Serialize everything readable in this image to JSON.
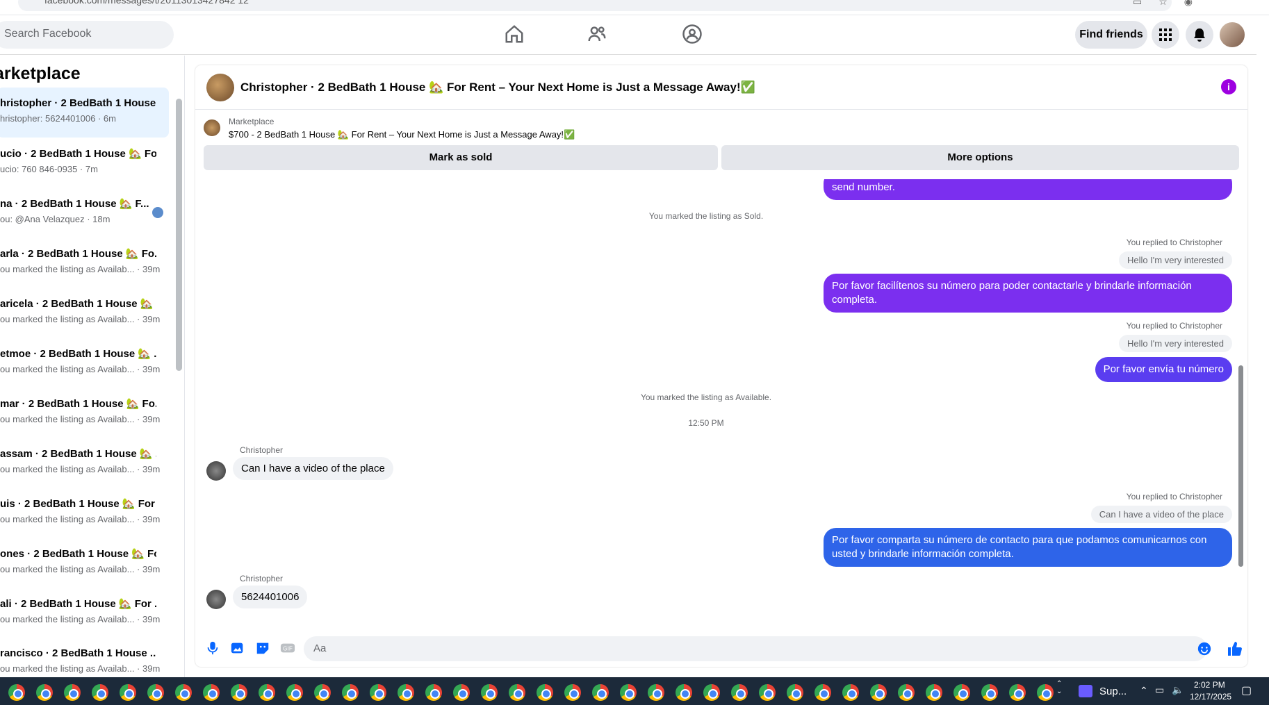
{
  "browser": {
    "url": "facebook.com/messages/t/20113013427842 12"
  },
  "nav": {
    "search_placeholder": "Search Facebook",
    "find_friends": "Find friends"
  },
  "sidebar": {
    "title": "arketplace",
    "threads": [
      {
        "name": "hristopher · 2 BedBath 1 House...",
        "sub": "hristopher: 5624401006 · 6m",
        "active": true
      },
      {
        "name": "ucio · 2 BedBath 1 House 🏡 Fo...",
        "sub": "ucio: 760 846-0935 · 7m"
      },
      {
        "name": "na · 2 BedBath 1 House 🏡 F...",
        "sub": "ou: @Ana Velazquez · 18m"
      },
      {
        "name": "arla · 2 BedBath 1 House 🏡 Fo...",
        "sub": "ou marked the listing as Availab... · 39m"
      },
      {
        "name": "aricela · 2 BedBath 1 House 🏡 ...",
        "sub": "ou marked the listing as Availab... · 39m"
      },
      {
        "name": "etmoe · 2 BedBath 1 House 🏡 ...",
        "sub": "ou marked the listing as Availab... · 39m"
      },
      {
        "name": "mar · 2 BedBath 1 House 🏡 Fo...",
        "sub": "ou marked the listing as Availab... · 39m"
      },
      {
        "name": "assam · 2 BedBath 1 House 🏡 ...",
        "sub": "ou marked the listing as Availab... · 39m"
      },
      {
        "name": "uis · 2 BedBath 1 House 🏡 For ...",
        "sub": "ou marked the listing as Availab... · 39m"
      },
      {
        "name": "ones · 2 BedBath 1 House 🏡 Fo...",
        "sub": "ou marked the listing as Availab... · 39m"
      },
      {
        "name": "ali · 2 BedBath 1 House 🏡 For ...",
        "sub": "ou marked the listing as Availab... · 39m"
      },
      {
        "name": "rancisco · 2 BedBath 1 House ...",
        "sub": "ou marked the listing as Availab... · 39m"
      }
    ]
  },
  "chat": {
    "title": "Christopher · 2 BedBath 1 House 🏡 For Rent – Your Next Home is Just a Message Away!✅",
    "marketplace_label": "Marketplace",
    "listing": "$700 - 2 BedBath 1 House 🏡 For Rent – Your Next Home is Just a Message Away!✅",
    "mark_sold": "Mark as sold",
    "more_options": "More options",
    "msg_top": "send  number.",
    "sys_sold": "You marked the listing as Sold.",
    "replied1": "You replied to Christopher",
    "quote1": "Hello I'm very interested",
    "out1": "Por favor facilítenos su número para poder contactarle y brindarle información completa.",
    "replied2": "You replied to Christopher",
    "quote2": "Hello I'm very interested",
    "out2": "Por favor envía tu número",
    "sys_available": "You marked the listing as Available.",
    "time": "12:50 PM",
    "in_name1": "Christopher",
    "in1": "Can I have a video of the place",
    "replied3": "You replied to Christopher",
    "quote3": "Can I have a video of the place",
    "out3": "Por favor comparta su número de contacto para que podamos comunicarnos con usted y brindarle información completa.",
    "in_name2": "Christopher",
    "in2": "5624401006",
    "composer_placeholder": "Aa"
  },
  "taskbar": {
    "app_label": "Sup...",
    "time": "2:02 PM",
    "date": "12/17/2025"
  }
}
